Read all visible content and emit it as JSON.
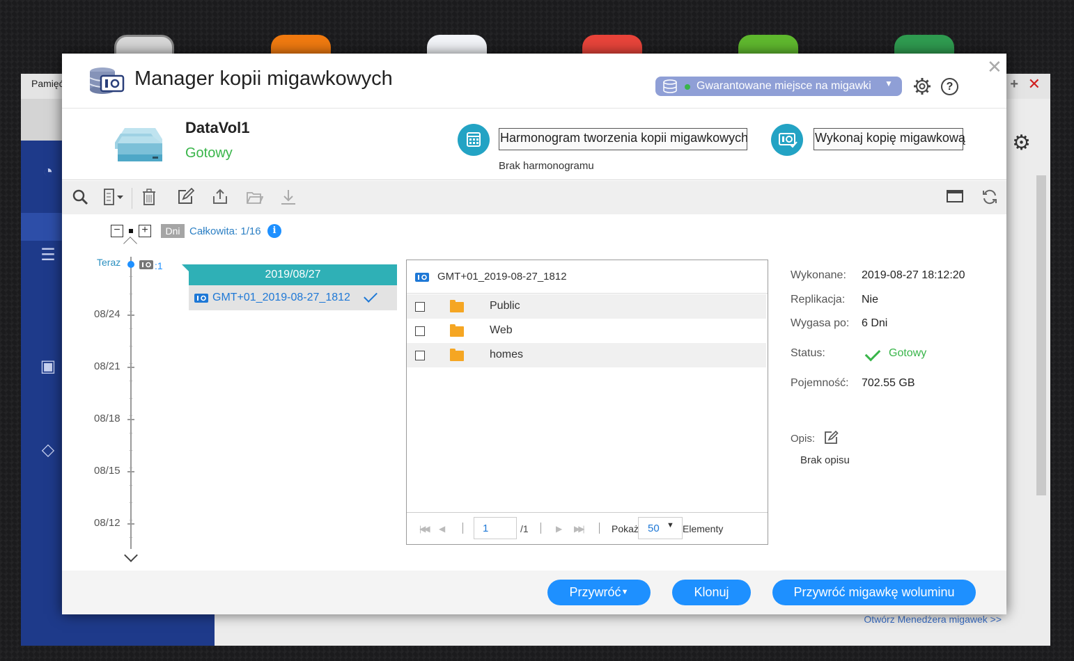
{
  "background_window": {
    "title": "Pamięć",
    "link": "Otwórz Menedżera migawek >>"
  },
  "dialog": {
    "title": "Manager kopii migawkowych",
    "space_button": "Gwarantowane miejsce na migawki",
    "icons": [
      "settings-icon",
      "help-icon",
      "close-icon"
    ]
  },
  "volume": {
    "name": "DataVol1",
    "status": "Gotowy",
    "schedule_button": "Harmonogram tworzenia kopii migawkowych",
    "schedule_note": "Brak harmonogramu",
    "snapshot_button": "Wykonaj kopię migawkową"
  },
  "timeline": {
    "unit": "Dni",
    "total": "Całkowita: 1/16",
    "now_label": "Teraz",
    "now_count": ":1",
    "labels": [
      "08/24",
      "08/21",
      "08/18",
      "08/15",
      "08/12"
    ]
  },
  "snapshot_list": {
    "date": "2019/08/27",
    "items": [
      {
        "name": "GMT+01_2019-08-27_1812",
        "selected": true
      }
    ]
  },
  "folders": {
    "snapshot_name": "GMT+01_2019-08-27_1812",
    "rows": [
      "Public",
      "Web",
      "homes"
    ],
    "pager": {
      "page": "1",
      "total": "/1",
      "show_label": "Pokaż",
      "per_page": "50",
      "elements_label": "Elementy"
    }
  },
  "details": {
    "executed_label": "Wykonane:",
    "executed_value": "2019-08-27 18:12:20",
    "replication_label": "Replikacja:",
    "replication_value": "Nie",
    "expires_label": "Wygasa po:",
    "expires_value": "6 Dni",
    "status_label": "Status:",
    "status_value": "Gotowy",
    "capacity_label": "Pojemność:",
    "capacity_value": "702.55 GB",
    "desc_label": "Opis:",
    "desc_value": "Brak opisu"
  },
  "footer": {
    "restore": "Przywróć",
    "clone": "Klonuj",
    "restore_volume": "Przywróć migawkę woluminu"
  },
  "colors": {
    "accent": "#1e90ff",
    "teal": "#2fb0b6",
    "success": "#39b54a",
    "pill": "#8f9fd6"
  }
}
